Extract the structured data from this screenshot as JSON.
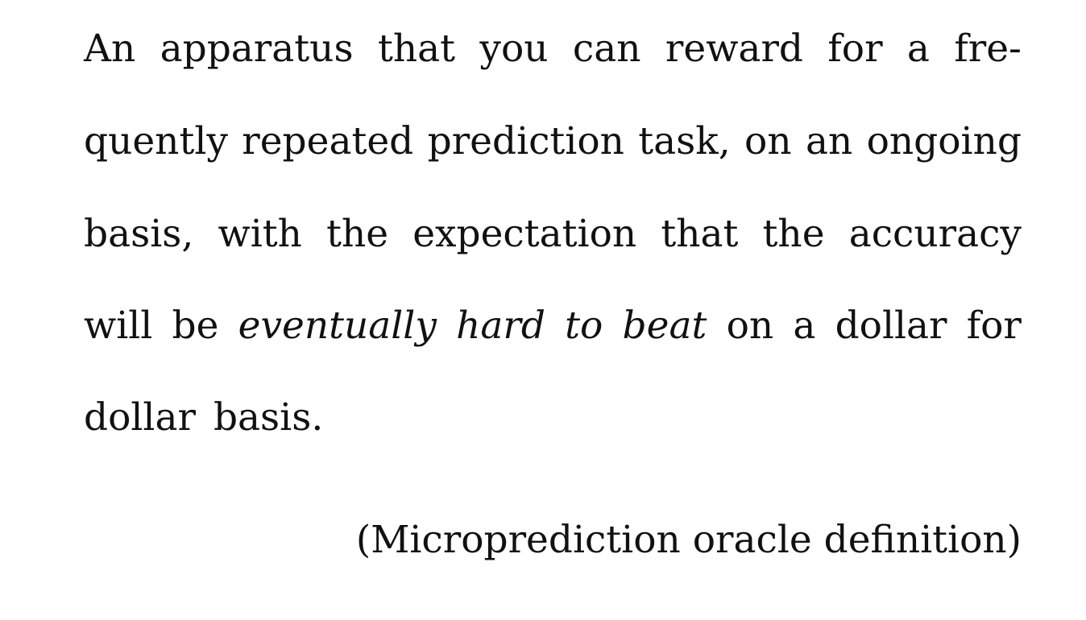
{
  "quote": {
    "lines": [
      {
        "words": [
          "An",
          "apparatus",
          "that",
          "you",
          "can",
          "reward",
          "for",
          "a",
          "fre-"
        ]
      },
      {
        "words": [
          "quently",
          "repeated",
          "prediction",
          "task,",
          "on",
          "an",
          "ongoing"
        ]
      },
      {
        "words": [
          "basis,",
          "with",
          "the",
          "expectation",
          "that",
          "the",
          "accuracy"
        ]
      },
      {
        "words": [
          "will",
          "be",
          "eventually",
          "hard",
          "to",
          "beat",
          "on",
          "a",
          "dollar",
          "for"
        ]
      },
      {
        "words": [
          "dollar",
          "basis."
        ]
      }
    ]
  },
  "caption": "(Microprediction oracle definition)"
}
